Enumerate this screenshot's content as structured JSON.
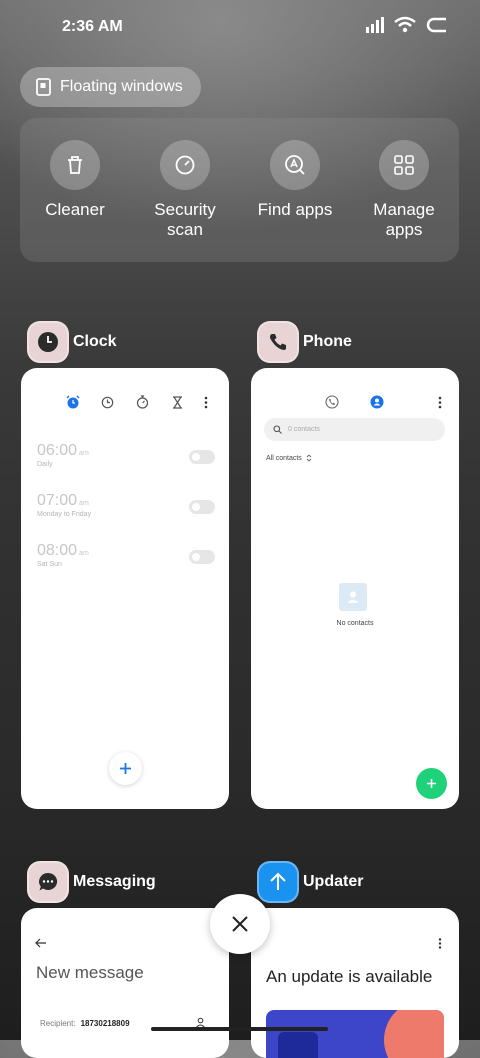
{
  "status": {
    "time": "2:36 AM"
  },
  "floating": {
    "label": "Floating windows"
  },
  "quick_actions": [
    {
      "label": "Cleaner",
      "icon": "trash-icon"
    },
    {
      "label": "Security\nscan",
      "icon": "shield-scan-icon"
    },
    {
      "label": "Find apps",
      "icon": "find-apps-icon"
    },
    {
      "label": "Manage\napps",
      "icon": "grid-icon"
    }
  ],
  "apps": {
    "clock": {
      "name": "Clock",
      "alarms": [
        {
          "time": "06:00",
          "ampm": "am",
          "repeat": "Daily"
        },
        {
          "time": "07:00",
          "ampm": "am",
          "repeat": "Monday to Friday"
        },
        {
          "time": "08:00",
          "ampm": "am",
          "repeat": "Sat Sun"
        }
      ]
    },
    "phone": {
      "name": "Phone",
      "search_placeholder": "0 contacts",
      "filter": "All contacts",
      "empty": "No contacts"
    },
    "messaging": {
      "name": "Messaging",
      "title": "New message",
      "recipient_label": "Recipient:",
      "recipient_value": "18730218809"
    },
    "updater": {
      "name": "Updater",
      "title": "An update is available"
    }
  },
  "colors": {
    "accent_blue": "#1a73e8",
    "fab_green": "#1fd27a",
    "updater_blue": "#1a93f0"
  }
}
